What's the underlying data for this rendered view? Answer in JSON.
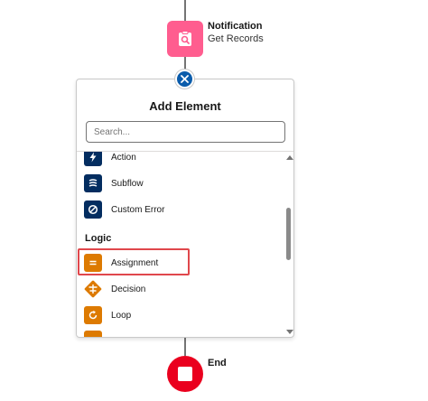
{
  "top_node": {
    "title": "Notification",
    "subtitle": "Get Records",
    "icon": "get-records-icon",
    "color": "#ff5d8f"
  },
  "panel": {
    "title": "Add Element",
    "search_placeholder": "Search...",
    "items_top": [
      {
        "label": "Action",
        "icon": "lightning-icon",
        "color": "#032d60"
      },
      {
        "label": "Subflow",
        "icon": "subflow-icon",
        "color": "#032d60"
      },
      {
        "label": "Custom Error",
        "icon": "ban-icon",
        "color": "#032d60"
      }
    ],
    "section": "Logic",
    "items_logic": [
      {
        "label": "Assignment",
        "icon": "assignment-icon",
        "color": "#dd7a01"
      },
      {
        "label": "Decision",
        "icon": "decision-icon",
        "color": "#dd7a01"
      },
      {
        "label": "Loop",
        "icon": "loop-icon",
        "color": "#dd7a01"
      }
    ]
  },
  "end_node": {
    "label": "End",
    "color": "#ea001e"
  },
  "highlight_color": "#e0474c"
}
